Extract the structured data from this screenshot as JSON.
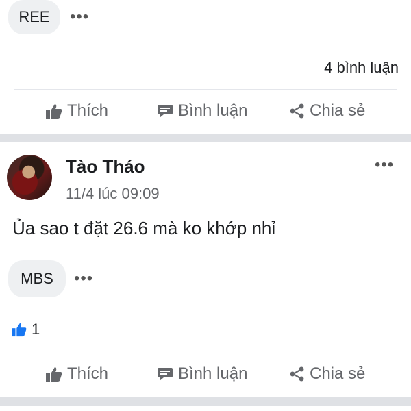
{
  "post1": {
    "tag": "REE",
    "more_icon": "more-dots-icon",
    "comment_count": "4 bình luận",
    "actions": {
      "like": "Thích",
      "comment": "Bình luận",
      "share": "Chia sẻ"
    }
  },
  "post2": {
    "author": "Tào Tháo",
    "timestamp": "11/4 lúc 09:09",
    "content": "Ủa sao t đặt 26.6 mà ko khớp nhỉ",
    "tag": "MBS",
    "like_count": "1",
    "actions": {
      "like": "Thích",
      "comment": "Bình luận",
      "share": "Chia sẻ"
    }
  },
  "colors": {
    "like_blue": "#1877f2",
    "action_gray": "#65676b",
    "separator": "#dfe1e5"
  }
}
